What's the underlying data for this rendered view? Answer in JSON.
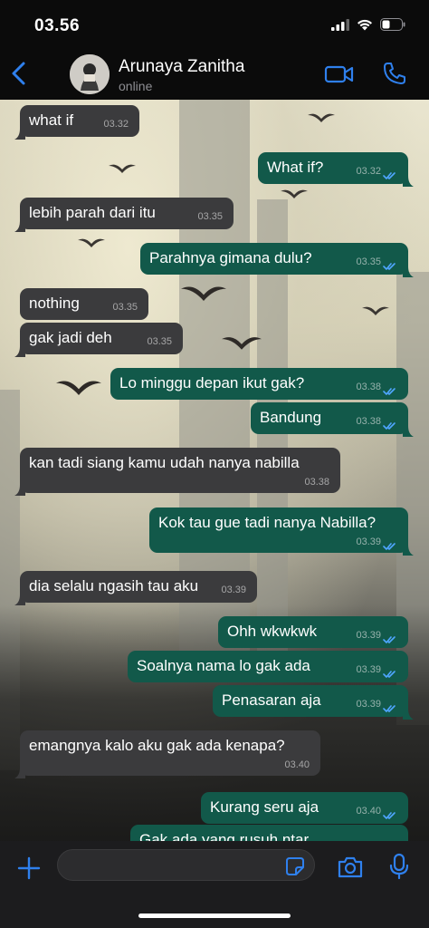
{
  "status": {
    "time": "03.56"
  },
  "contact": {
    "name": "Arunaya Zanitha",
    "status": "online"
  },
  "colors": {
    "accent": "#2f80ed",
    "incoming": "#3b3b3d",
    "outgoing": "#12594a",
    "read_ticks": "#4fa6ff"
  },
  "icons": [
    "back-chevron-icon",
    "video-call-icon",
    "phone-icon",
    "plus-icon",
    "sticker-icon",
    "camera-icon",
    "mic-icon",
    "double-check-icon"
  ],
  "messages": [
    {
      "dir": "in",
      "text": "what if",
      "time": "03.32"
    },
    {
      "dir": "out",
      "text": "What if?",
      "time": "03.32"
    },
    {
      "dir": "in",
      "text": "lebih parah dari itu",
      "time": "03.35"
    },
    {
      "dir": "out",
      "text": "Parahnya gimana dulu?",
      "time": "03.35"
    },
    {
      "dir": "in",
      "text": "nothing",
      "time": "03.35"
    },
    {
      "dir": "in",
      "text": "gak jadi deh",
      "time": "03.35"
    },
    {
      "dir": "out",
      "text": "Lo minggu depan ikut gak?",
      "time": "03.38"
    },
    {
      "dir": "out",
      "text": "Bandung",
      "time": "03.38"
    },
    {
      "dir": "in",
      "text": "kan tadi siang kamu udah nanya nabilla",
      "time": "03.38"
    },
    {
      "dir": "out",
      "text": "Kok tau gue tadi nanya Nabilla?",
      "time": "03.39"
    },
    {
      "dir": "in",
      "text": "dia selalu ngasih tau aku",
      "time": "03.39"
    },
    {
      "dir": "out",
      "text": "Ohh wkwkwk",
      "time": "03.39"
    },
    {
      "dir": "out",
      "text": "Soalnya nama lo gak ada",
      "time": "03.39"
    },
    {
      "dir": "out",
      "text": "Penasaran aja",
      "time": "03.39"
    },
    {
      "dir": "in",
      "text": "emangnya kalo aku gak ada kenapa?",
      "time": "03.40"
    },
    {
      "dir": "out",
      "text": "Kurang seru aja",
      "time": "03.40"
    },
    {
      "dir": "out",
      "text": "Gak ada yang rusuh ntar",
      "time": ""
    }
  ]
}
